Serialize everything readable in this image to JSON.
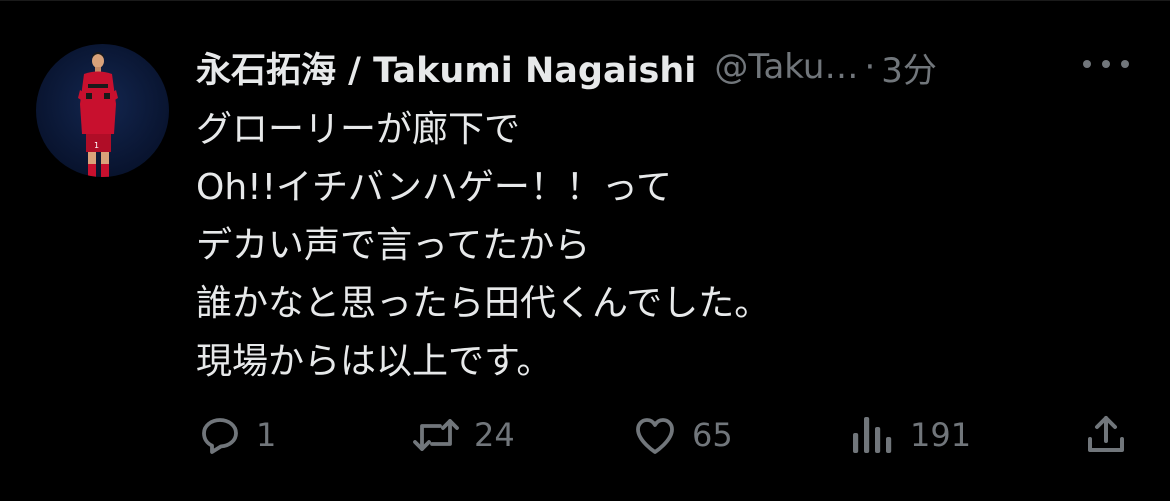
{
  "tweet": {
    "display_name": "永石拓海 / Takumi Nagaishi",
    "handle": "@Taku…",
    "separator": "·",
    "time": "3分",
    "lines": [
      "グローリーが廊下で",
      "Oh!!イチバンハゲー！！って",
      "デカい声で言ってたから",
      "誰かなと思ったら田代くんでした。",
      "現場からは以上です。"
    ]
  },
  "actions": {
    "reply_count": "1",
    "retweet_count": "24",
    "like_count": "65",
    "views_count": "191"
  },
  "icons": {
    "more": "more-horizontal-icon",
    "reply": "reply-icon",
    "retweet": "retweet-icon",
    "like": "heart-icon",
    "views": "analytics-icon",
    "share": "share-icon"
  },
  "colors": {
    "background": "#000000",
    "text_primary": "#e7e9ea",
    "text_secondary": "#71767b",
    "avatar_bg": "#0b1a3a",
    "jersey_red": "#c8102e"
  }
}
